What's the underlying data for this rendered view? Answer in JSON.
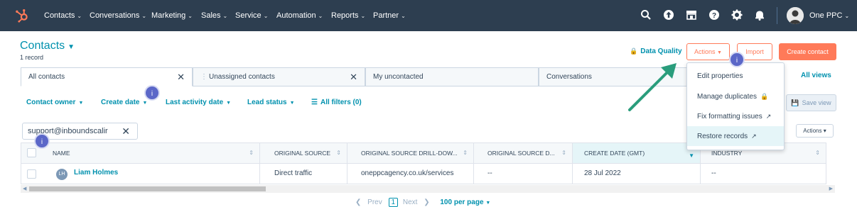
{
  "nav": {
    "items": [
      {
        "label": "Contacts"
      },
      {
        "label": "Conversations"
      },
      {
        "label": "Marketing"
      },
      {
        "label": "Sales"
      },
      {
        "label": "Service"
      },
      {
        "label": "Automation"
      },
      {
        "label": "Reports"
      },
      {
        "label": "Partner"
      }
    ],
    "account_label": "One PPC",
    "icons": [
      "search-icon",
      "upgrade-icon",
      "marketplace-icon",
      "help-icon",
      "settings-icon",
      "notifications-icon"
    ]
  },
  "header": {
    "title": "Contacts",
    "record_count": "1 record",
    "data_quality_label": "Data Quality",
    "actions_label": "Actions",
    "import_label": "Import",
    "create_label": "Create contact"
  },
  "tabs": [
    {
      "label": "All contacts"
    },
    {
      "label": "Unassigned contacts"
    },
    {
      "label": "My uncontacted"
    },
    {
      "label": "Conversations"
    }
  ],
  "tab_hint": ")",
  "all_views_label": "All views",
  "filters": {
    "contact_owner": "Contact owner",
    "create_date": "Create date",
    "last_activity": "Last activity date",
    "lead_status": "Lead status",
    "all_filters": "All filters (0)",
    "save_view": "Save view"
  },
  "search": {
    "value": "support@inboundscalir"
  },
  "table_actions_label": "Actions",
  "table": {
    "headers": [
      "NAME",
      "ORIGINAL SOURCE",
      "ORIGINAL SOURCE DRILL-DOW...",
      "ORIGINAL SOURCE D...",
      "CREATE DATE (GMT)",
      "INDUSTRY"
    ],
    "rows": [
      {
        "initials": "LH",
        "name": "Liam Holmes",
        "source": "Direct traffic",
        "drill": "oneppcagency.co.uk/services",
        "drill2": "--",
        "created": "28 Jul 2022",
        "industry": "--"
      }
    ]
  },
  "pagination": {
    "prev": "Prev",
    "current": "1",
    "next": "Next",
    "per_page": "100 per page"
  },
  "actions_menu": [
    {
      "label": "Edit properties"
    },
    {
      "label": "Manage duplicates"
    },
    {
      "label": "Fix formatting issues"
    },
    {
      "label": "Restore records"
    }
  ],
  "hint_badge": "i",
  "colors": {
    "nav_bg": "#2d3e50",
    "accent": "#ff7a59",
    "link": "#0091ae",
    "badge": "#5b67c8",
    "arrow": "#2a9d7c"
  }
}
